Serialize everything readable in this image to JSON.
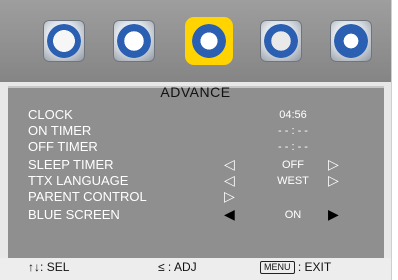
{
  "menu": {
    "tabs": [
      {
        "name": "picture",
        "icon": "palette-icon",
        "selected": false
      },
      {
        "name": "sound",
        "icon": "music-note-icon",
        "selected": false
      },
      {
        "name": "advance",
        "icon": "wrench-screwdriver-icon",
        "selected": true
      },
      {
        "name": "teletext",
        "icon": "tv-screen-icon",
        "selected": false
      },
      {
        "name": "search",
        "icon": "magnifier-icon",
        "selected": false
      }
    ],
    "title": "ADVANCE"
  },
  "settings": [
    {
      "label": "CLOCK",
      "value": "04:56"
    },
    {
      "label": "ON TIMER",
      "value": "- - : - -"
    },
    {
      "label": "OFF TIMER",
      "value": "- - : - -"
    },
    {
      "label": "SLEEP TIMER",
      "value": "OFF",
      "arrows": true
    },
    {
      "label": "TTX LANGUAGE",
      "value": "WEST",
      "arrows": true
    },
    {
      "label": "PARENT CONTROL",
      "value": "",
      "right_arrow_only": true
    },
    {
      "label": "BLUE SCREEN",
      "value": "ON",
      "arrows": true,
      "highlighted": true
    }
  ],
  "hints": {
    "sel": "SEL",
    "adj": "ADJ",
    "menu_key": "MENU",
    "exit": "EXIT"
  },
  "colors": {
    "top_bar": "#8f8f8f",
    "panel": "#8f8f8f",
    "selected_tab": "#ffd400"
  }
}
